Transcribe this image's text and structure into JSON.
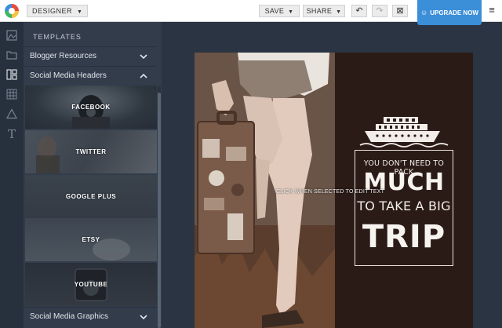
{
  "topbar": {
    "mode_label": "DESIGNER",
    "save_label": "SAVE",
    "share_label": "SHARE",
    "undo_icon": "undo-icon",
    "redo_icon": "redo-icon",
    "close_icon": "close-box-icon",
    "upgrade_label": "UPGRADE NOW",
    "menu_icon": "hamburger-icon"
  },
  "rail": {
    "icons": [
      "layouts-icon",
      "folder-icon",
      "templates-icon",
      "grid-icon",
      "shapes-icon",
      "text-icon"
    ]
  },
  "panel": {
    "title": "TEMPLATES",
    "sections": [
      {
        "label": "Blogger Resources",
        "expanded": false
      },
      {
        "label": "Social Media Headers",
        "expanded": true
      },
      {
        "label": "Social Media Graphics",
        "expanded": false
      }
    ],
    "tiles": [
      "FACEBOOK",
      "TWITTER",
      "GOOGLE PLUS",
      "ETSY",
      "YOUTUBE"
    ]
  },
  "canvas": {
    "line1": "YOU DON'T NEED TO PACK",
    "line2": "MUCH",
    "line3": "TO TAKE A BIG",
    "line4": "TRIP",
    "hint": "CLICK WHEN SELECTED TO EDIT TEXT",
    "colors": {
      "dark_pane": "#2b1b16",
      "text": "#f2ede8"
    }
  },
  "colors": {
    "accent": "#3b8ed8",
    "panel_bg": "#323c4b",
    "app_bg": "#2b3442"
  }
}
